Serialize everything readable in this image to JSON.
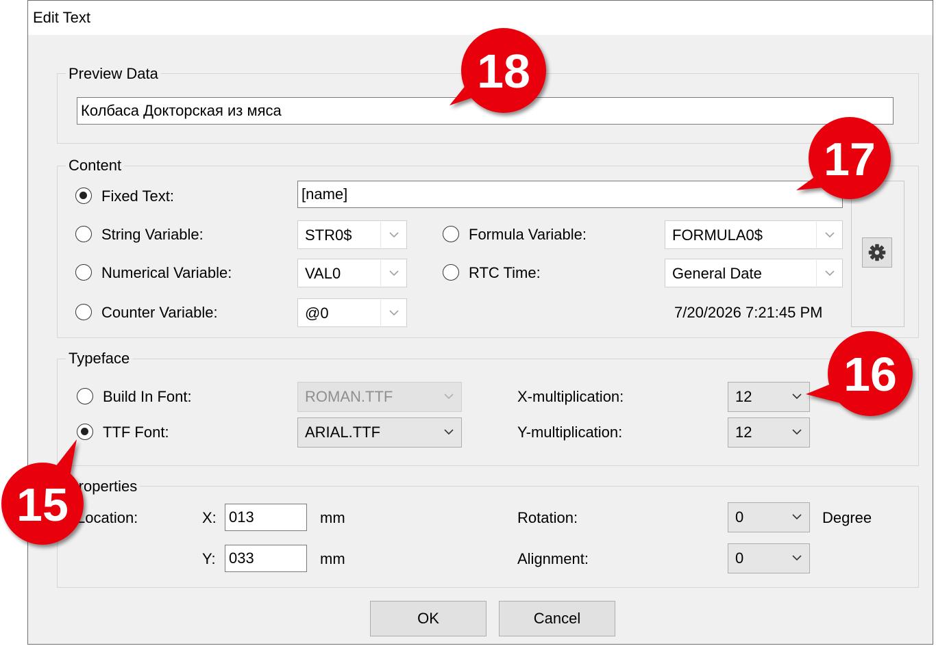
{
  "window": {
    "title": "Edit Text"
  },
  "preview": {
    "legend": "Preview Data",
    "value": "Колбаса Докторская из мяса"
  },
  "content": {
    "legend": "Content",
    "fixed_text": {
      "label": "Fixed Text:",
      "value": "[name]",
      "selected": true
    },
    "string_var": {
      "label": "String Variable:",
      "value": "STR0$"
    },
    "numerical_var": {
      "label": "Numerical Variable:",
      "value": "VAL0"
    },
    "counter_var": {
      "label": "Counter Variable:",
      "value": "@0"
    },
    "formula_var": {
      "label": "Formula Variable:",
      "value": "FORMULA0$"
    },
    "rtc_time": {
      "label": "RTC Time:",
      "value": "General Date"
    },
    "timestamp": "7/20/2026 7:21:45 PM",
    "settings_icon": "gear-icon"
  },
  "typeface": {
    "legend": "Typeface",
    "build_in": {
      "label": "Build In Font:",
      "value": "ROMAN.TTF"
    },
    "ttf": {
      "label": "TTF Font:",
      "value": "ARIAL.TTF",
      "selected": true
    },
    "x_mult": {
      "label": "X-multiplication:",
      "value": "12"
    },
    "y_mult": {
      "label": "Y-multiplication:",
      "value": "12"
    }
  },
  "properties": {
    "legend": "Properties",
    "location_label": "Location:",
    "x_label": "X:",
    "x_value": "013",
    "x_unit": "mm",
    "y_label": "Y:",
    "y_value": "033",
    "y_unit": "mm",
    "rotation": {
      "label": "Rotation:",
      "value": "0",
      "unit": "Degree"
    },
    "alignment": {
      "label": "Alignment:",
      "value": "0"
    }
  },
  "buttons": {
    "ok": "OK",
    "cancel": "Cancel"
  },
  "callouts": {
    "c15": "15",
    "c16": "16",
    "c17": "17",
    "c18": "18"
  },
  "colors": {
    "callout_red": "#e8000b",
    "dialog_bg": "#f0f0f0"
  }
}
